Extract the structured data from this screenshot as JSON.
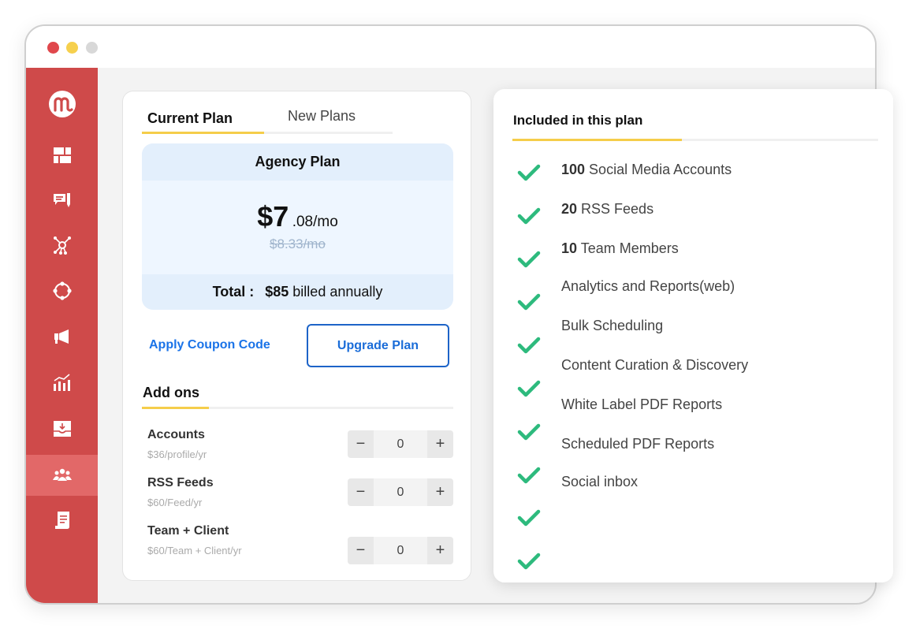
{
  "window": {
    "traffic_lights": [
      "close",
      "minimize",
      "zoom"
    ]
  },
  "sidebar": {
    "logo": "mention-logo",
    "items": [
      {
        "name": "dashboard",
        "icon": "dashboard-icon",
        "active": false
      },
      {
        "name": "publish",
        "icon": "compose-icon",
        "active": false
      },
      {
        "name": "network",
        "icon": "network-icon",
        "active": false
      },
      {
        "name": "connections",
        "icon": "circle-nodes-icon",
        "active": false
      },
      {
        "name": "campaigns",
        "icon": "megaphone-icon",
        "active": false
      },
      {
        "name": "analytics",
        "icon": "analytics-icon",
        "active": false
      },
      {
        "name": "inbox",
        "icon": "inbox-download-icon",
        "active": false
      },
      {
        "name": "team",
        "icon": "team-icon",
        "active": true
      },
      {
        "name": "billing",
        "icon": "receipt-icon",
        "active": false
      }
    ]
  },
  "plan_panel": {
    "tabs": [
      {
        "label": "Current Plan",
        "active": true
      },
      {
        "label": "New Plans",
        "active": false
      }
    ],
    "plan": {
      "name": "Agency Plan",
      "price_main": "$7",
      "price_cents": ".08/mo",
      "price_old": "$8.33/mo",
      "total_label": "Total :",
      "total_amount": "$85",
      "total_suffix": "billed annually"
    },
    "coupon_label": "Apply Coupon Code",
    "upgrade_label": "Upgrade Plan",
    "addons_title": "Add ons",
    "addons": [
      {
        "name": "Accounts",
        "price": "$36/profile/yr",
        "value": "0"
      },
      {
        "name": "RSS Feeds",
        "price": "$60/Feed/yr",
        "value": "0"
      },
      {
        "name": "Team + Client",
        "price": "$60/Team + Client/yr",
        "value": "0"
      }
    ],
    "stepper_minus": "−",
    "stepper_plus": "+"
  },
  "included_panel": {
    "title": "Included in this plan",
    "features": [
      {
        "bold": "100",
        "text": " Social Media Accounts"
      },
      {
        "bold": "20",
        "text": " RSS Feeds"
      },
      {
        "bold": "10",
        "text": " Team Members"
      },
      {
        "bold": "",
        "text": "Analytics and Reports(web)"
      },
      {
        "bold": "",
        "text": "Bulk Scheduling"
      },
      {
        "bold": "",
        "text": "Content Curation & Discovery"
      },
      {
        "bold": "",
        "text": "White Label PDF Reports"
      },
      {
        "bold": "",
        "text": "Scheduled PDF Reports"
      },
      {
        "bold": "",
        "text": "Social inbox"
      }
    ],
    "check_count": 10,
    "check_color": "#2dba7d"
  },
  "colors": {
    "brand": "#cf4a4a",
    "accent_yellow": "#f5cd4a",
    "link_blue": "#1a73e8"
  }
}
